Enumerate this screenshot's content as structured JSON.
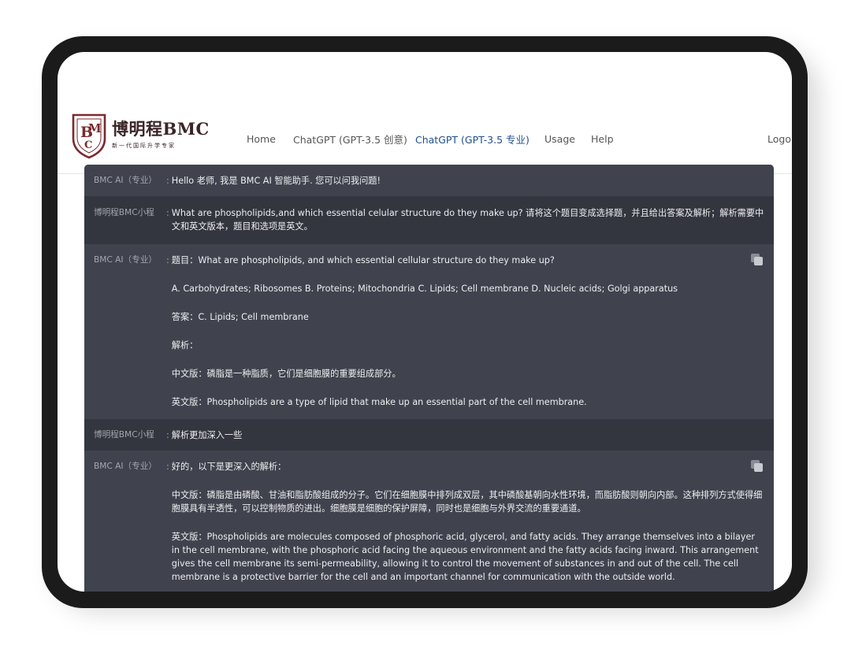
{
  "logo": {
    "title": "博明程BMC",
    "subtitle": "新一代国际升学专家"
  },
  "nav": {
    "home": "Home",
    "chatgpt_creative": "ChatGPT (GPT-3.5 创意)",
    "chatgpt_pro": "ChatGPT (GPT-3.5 专业)",
    "usage": "Usage",
    "help": "Help",
    "logout": "Logout"
  },
  "chat": {
    "ai_name": "BMC AI（专业）",
    "user_name": "博明程BMC小程",
    "colon": ":",
    "m1": {
      "text": "Hello 老师, 我是 BMC AI 智能助手. 您可以问我问题!"
    },
    "m2": {
      "text": "What are phospholipids,and which essential celular structure do they make up? 请将这个题目变成选择题，并且给出答案及解析；解析需要中文和英文版本，题目和选项是英文。"
    },
    "m3": {
      "question": "题目：What are phospholipids, and which essential cellular structure do they make up?",
      "options": "A. Carbohydrates; Ribosomes B. Proteins; Mitochondria C. Lipids; Cell membrane D. Nucleic acids; Golgi apparatus",
      "answer": "答案：C. Lipids; Cell membrane",
      "analysis_label": "解析：",
      "zh": "中文版：磷脂是一种脂质，它们是细胞膜的重要组成部分。",
      "en": "英文版：Phospholipids are a type of lipid that make up an essential part of the cell membrane."
    },
    "m4": {
      "text": "解析更加深入一些"
    },
    "m5": {
      "intro": "好的，以下是更深入的解析：",
      "zh": "中文版：磷脂是由磷酸、甘油和脂肪酸组成的分子。它们在细胞膜中排列成双层，其中磷酸基朝向水性环境，而脂肪酸则朝向内部。这种排列方式使得细胞膜具有半透性，可以控制物质的进出。细胞膜是细胞的保护屏障，同时也是细胞与外界交流的重要通道。",
      "en": "英文版：Phospholipids are molecules composed of phosphoric acid, glycerol, and fatty acids. They arrange themselves into a bilayer in the cell membrane, with the phosphoric acid facing the aqueous environment and the fatty acids facing inward. This arrangement gives the cell membrane its semi-permeability, allowing it to control the movement of substances in and out of the cell. The cell membrane is a protective barrier for the cell and an important channel for communication with the outside world."
    }
  },
  "colors": {
    "device": "#1b1b1b",
    "chat_bg": "#40434e",
    "user_row": "#33353f",
    "logo": "#7a2a2f",
    "active_nav": "#1f4f8a"
  }
}
